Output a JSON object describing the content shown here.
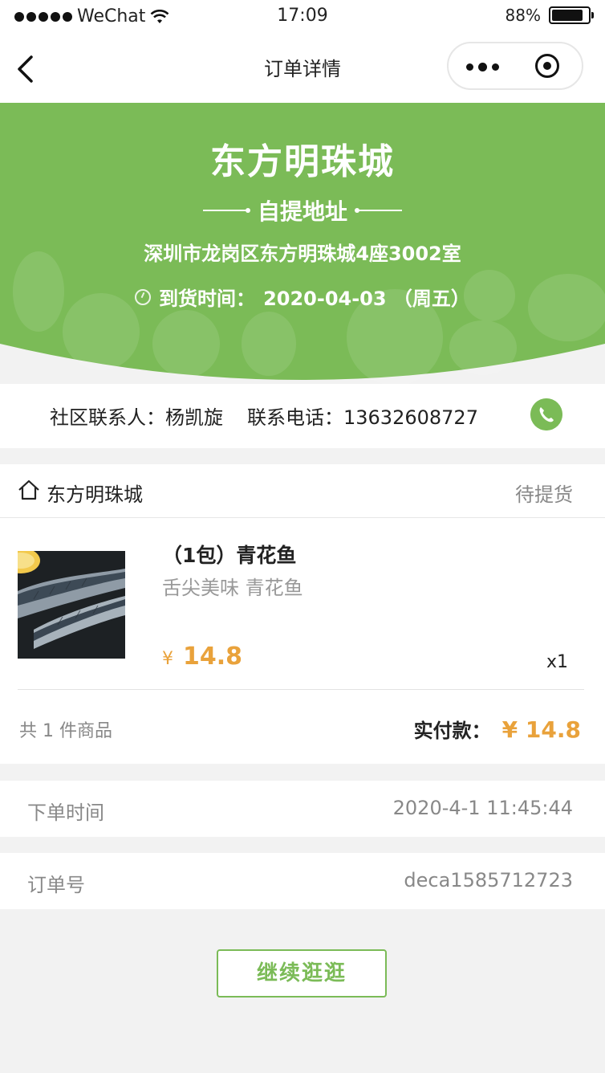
{
  "status_bar": {
    "carrier": "WeChat",
    "time": "17:09",
    "battery": "88%"
  },
  "nav": {
    "title": "订单详情"
  },
  "colors": {
    "accent_green": "#7bbb57",
    "price_orange": "#e9a23b"
  },
  "pickup": {
    "store_name": "东方明珠城",
    "section_title": "自提地址",
    "address": "深圳市龙岗区东方明珠城4座3002室",
    "arrival_label": "到货时间：",
    "arrival_date": "2020-04-03 （周五）"
  },
  "contact": {
    "person_label": "社区联系人：",
    "person_name": "杨凯旋",
    "phone_label": "联系电话：",
    "phone_number": "13632608727"
  },
  "order": {
    "shop_name": "东方明珠城",
    "status": "待提货",
    "product": {
      "name": "（1包）青花鱼",
      "description": "舌尖美味 青花鱼",
      "currency": "¥",
      "price": "14.8",
      "quantity": "x1"
    },
    "item_count": "共 1 件商品",
    "paid_label": "实付款：",
    "paid_amount": "¥ 14.8"
  },
  "details": {
    "order_time_label": "下单时间",
    "order_time_value": "2020-4-1 11:45:44",
    "order_no_label": "订单号",
    "order_no_value": "deca1585712723"
  },
  "actions": {
    "continue_label": "继续逛逛"
  }
}
